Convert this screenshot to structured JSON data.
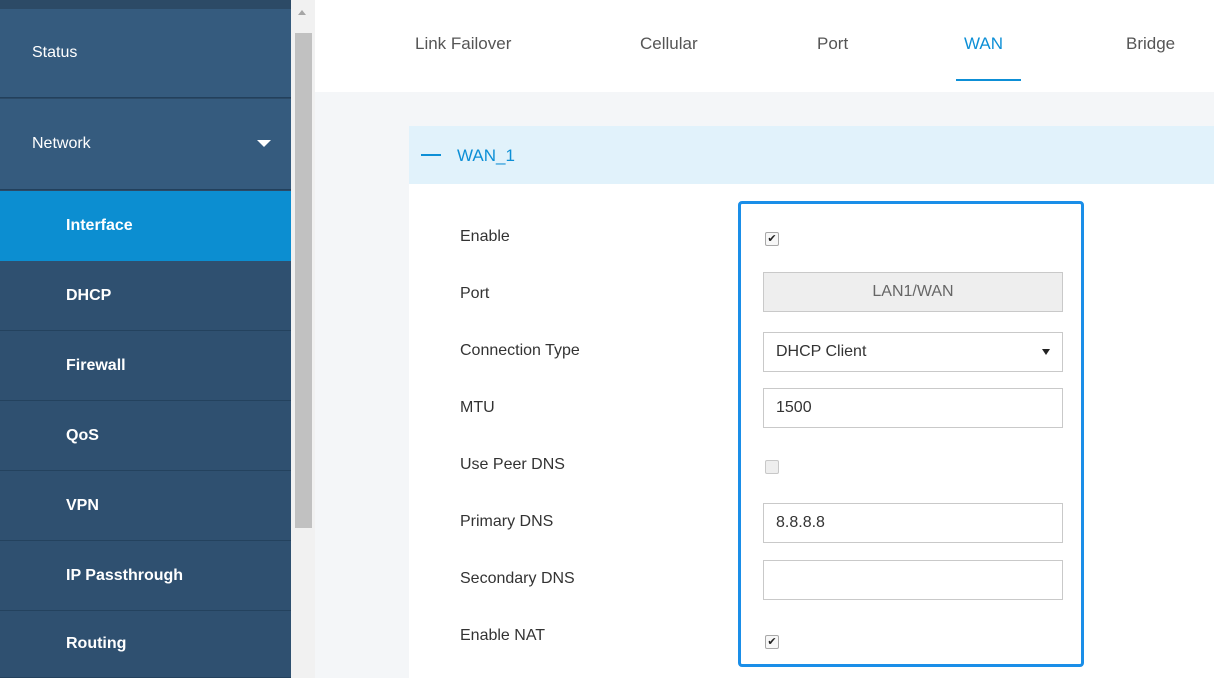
{
  "sidebar": {
    "items": [
      {
        "label": "Status"
      },
      {
        "label": "Network"
      },
      {
        "label": "Interface"
      },
      {
        "label": "DHCP"
      },
      {
        "label": "Firewall"
      },
      {
        "label": "QoS"
      },
      {
        "label": "VPN"
      },
      {
        "label": "IP Passthrough"
      },
      {
        "label": "Routing"
      }
    ],
    "active_item": "Interface",
    "expanded_group": "Network"
  },
  "tabs": {
    "items": [
      {
        "label": "Link Failover"
      },
      {
        "label": "Cellular"
      },
      {
        "label": "Port"
      },
      {
        "label": "WAN"
      },
      {
        "label": "Bridge"
      }
    ],
    "active": "WAN"
  },
  "panel": {
    "title": "WAN_1",
    "collapse_icon": "minus-icon"
  },
  "form": {
    "enable": {
      "label": "Enable",
      "checked": true
    },
    "port": {
      "label": "Port",
      "value": "LAN1/WAN"
    },
    "connection_type": {
      "label": "Connection Type",
      "value": "DHCP Client"
    },
    "mtu": {
      "label": "MTU",
      "value": "1500"
    },
    "use_peer_dns": {
      "label": "Use Peer DNS",
      "checked": false
    },
    "primary_dns": {
      "label": "Primary DNS",
      "value": "8.8.8.8"
    },
    "secondary_dns": {
      "label": "Secondary DNS",
      "value": ""
    },
    "enable_nat": {
      "label": "Enable NAT",
      "checked": true
    }
  },
  "colors": {
    "sidebar_bg": "#2c4a66",
    "active_item": "#0c8ed1",
    "accent": "#0d8fd6",
    "highlight_border": "#1a8ee8"
  }
}
